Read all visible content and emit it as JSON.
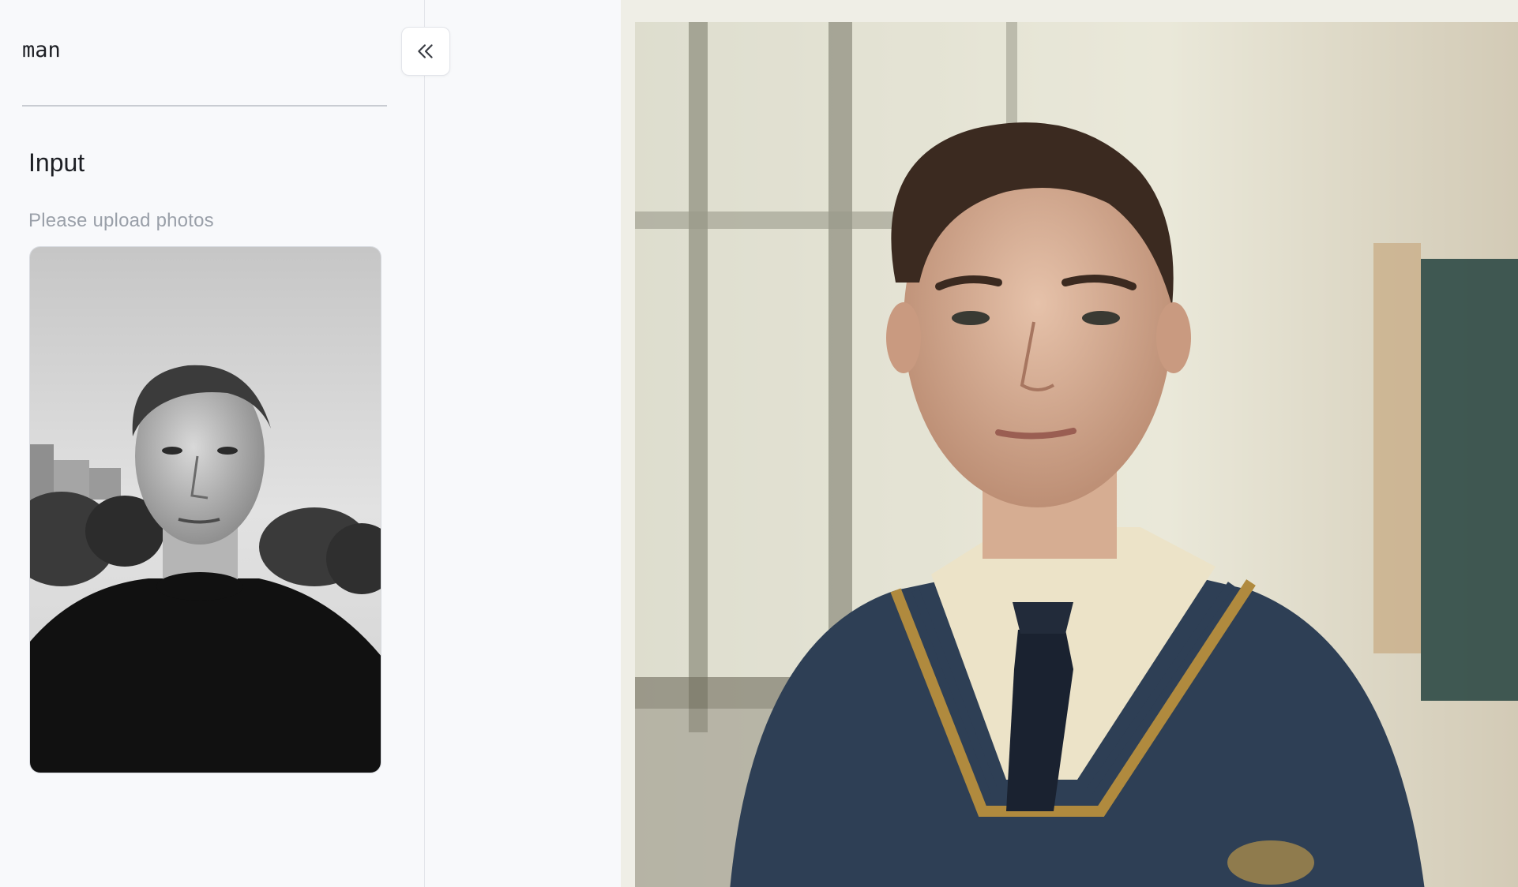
{
  "prompt": {
    "text": "man"
  },
  "sidebar": {
    "collapse_icon": "double-chevron-left-icon"
  },
  "input_section": {
    "title": "Input",
    "hint": "Please upload photos"
  },
  "colors": {
    "background": "#f8f9fb",
    "border": "#e3e5ea",
    "text_primary": "#1d1f24",
    "text_muted": "#9aa0a9",
    "sweater_navy": "#2e3f55",
    "sweater_trim_gold": "#b08a3e"
  }
}
